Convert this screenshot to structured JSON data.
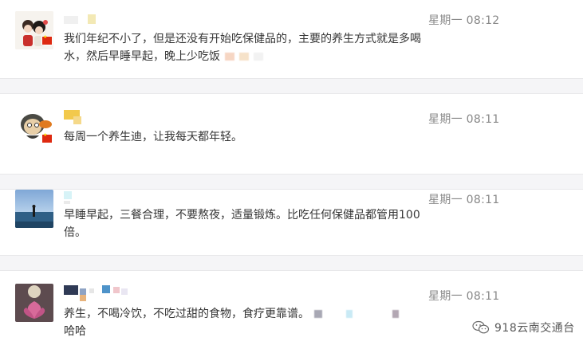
{
  "comments": [
    {
      "time": "星期一 08:12",
      "text": "我们年纪不小了，但是还没有开始吃保健品的，主要的养生方式就是多喝水，然后早睡早起，晚上少吃饭"
    },
    {
      "time": "星期一 08:11",
      "text": "每周一个养生迪，让我每天都年轻。"
    },
    {
      "time": "星期一 08:11",
      "text": "早睡早起，三餐合理，不要熬夜，适量锻炼。比吃任何保健品都管用100倍。"
    },
    {
      "time": "星期一 08:11",
      "text": "养生，不喝冷饮，不吃过甜的食物，食疗更靠谱。",
      "text2": "哈哈"
    }
  ],
  "watermark": {
    "text": "918云南交通台",
    "icon": "wechat-icon"
  },
  "colors": {
    "separator": "#f5f5f7",
    "time": "#888888",
    "text": "#353535"
  }
}
